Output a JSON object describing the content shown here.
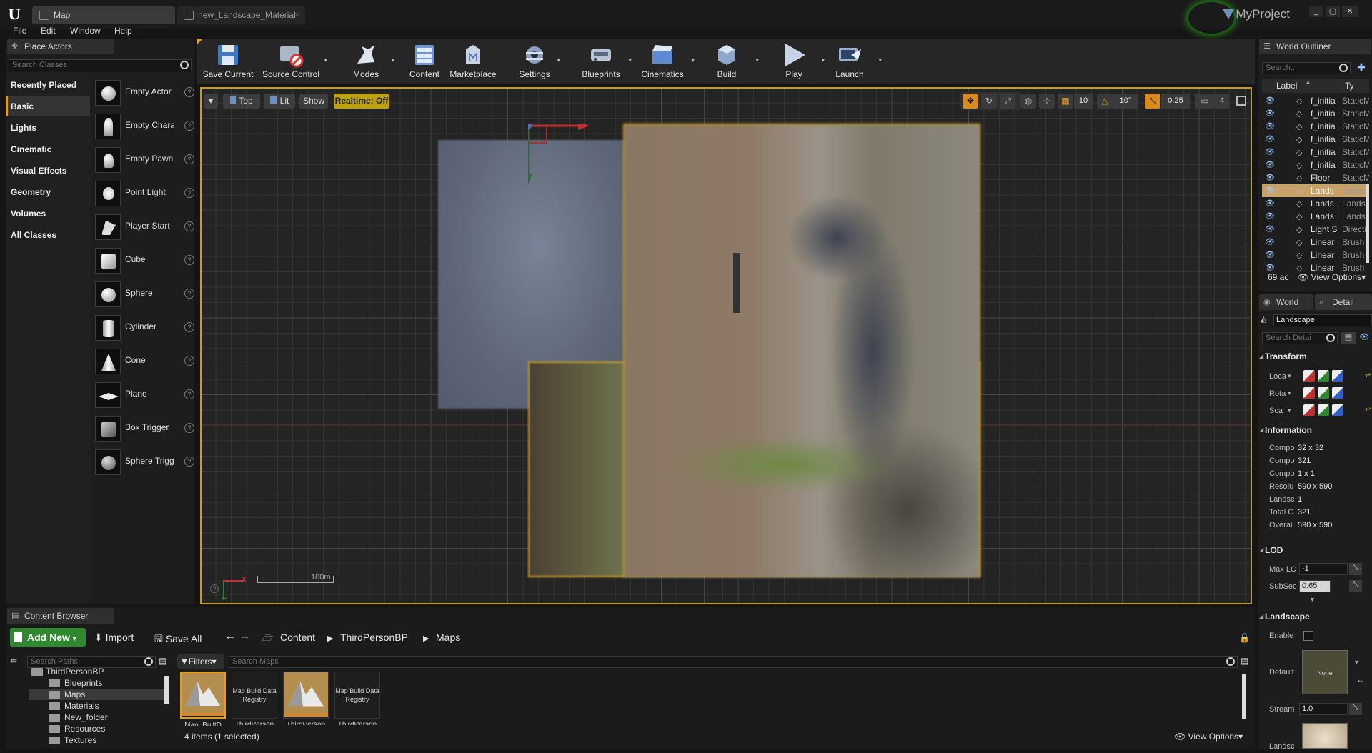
{
  "window": {
    "logo": "U",
    "project_name": "MyProject",
    "tabs": [
      {
        "label": "Map",
        "close": "×"
      },
      {
        "label": "new_Landscape_Material",
        "close": "×"
      }
    ],
    "controls": [
      "_",
      "▢",
      "✕"
    ]
  },
  "menu": [
    "File",
    "Edit",
    "Window",
    "Help"
  ],
  "place_actors": {
    "tab": "Place Actors",
    "search_placeholder": "Search Classes",
    "categories": [
      "Recently Placed",
      "Basic",
      "Lights",
      "Cinematic",
      "Visual Effects",
      "Geometry",
      "Volumes",
      "All Classes"
    ],
    "selected_category": "Basic",
    "items": [
      "Empty Actor",
      "Empty Character",
      "Empty Pawn",
      "Point Light",
      "Player Start",
      "Cube",
      "Sphere",
      "Cylinder",
      "Cone",
      "Plane",
      "Box Trigger",
      "Sphere Trigger"
    ],
    "help_glyph": "?"
  },
  "toolbar": {
    "buttons": [
      "Save Current",
      "Source Control",
      "Modes",
      "Content",
      "Marketplace",
      "Settings",
      "Blueprints",
      "Cinematics",
      "Build",
      "Play",
      "Launch"
    ],
    "dropdown_glyph": "▾"
  },
  "viewport": {
    "menu_glyph": "▾",
    "view": "Top",
    "lighting": "Lit",
    "show": "Show",
    "realtime": "Realtime: Off",
    "grid_snap": "10",
    "rotation_snap": "10°",
    "scale_snap": "0.25",
    "camera_speed": "4",
    "scale_label": "100m",
    "axis_x": "X",
    "axis_y": "Y"
  },
  "world_outliner": {
    "tab": "World Outliner",
    "search_placeholder": "Search...",
    "col_label": "Label",
    "col_type": "Ty",
    "rows": [
      {
        "label": "f_initia",
        "type": "StaticM",
        "selected": false
      },
      {
        "label": "f_initia",
        "type": "StaticM",
        "selected": false
      },
      {
        "label": "f_initia",
        "type": "StaticM",
        "selected": false
      },
      {
        "label": "f_initia",
        "type": "StaticM",
        "selected": false
      },
      {
        "label": "f_initia",
        "type": "StaticM",
        "selected": false
      },
      {
        "label": "f_initia",
        "type": "StaticM",
        "selected": false
      },
      {
        "label": "Floor",
        "type": "StaticM",
        "selected": false
      },
      {
        "label": "Lands",
        "type": "Landsc",
        "selected": true
      },
      {
        "label": "Lands",
        "type": "Landsc",
        "selected": false
      },
      {
        "label": "Lands",
        "type": "Landsc",
        "selected": false
      },
      {
        "label": "Light S",
        "type": "Directi",
        "selected": false
      },
      {
        "label": "Linear",
        "type": "Brush",
        "selected": false
      },
      {
        "label": "Linear",
        "type": "Brush",
        "selected": false
      },
      {
        "label": "Linear",
        "type": "Brush",
        "selected": false
      }
    ],
    "count": "69 ac",
    "view_options": "View Options"
  },
  "details": {
    "tab_world": "World",
    "tab_details": "Detail",
    "object_name": "Landscape",
    "search_placeholder": "Search Detai",
    "transform_title": "Transform",
    "transform_rows": [
      "Loca",
      "Rota",
      "Sca"
    ],
    "information_title": "Information",
    "info_rows": [
      {
        "label": "Compo",
        "value": "32 x 32"
      },
      {
        "label": "Compo",
        "value": "321"
      },
      {
        "label": "Compo",
        "value": "1 x 1"
      },
      {
        "label": "Resolu",
        "value": "590 x 590"
      },
      {
        "label": "Landsc",
        "value": "1"
      },
      {
        "label": "Total C",
        "value": "321"
      },
      {
        "label": "Overal",
        "value": "590 x 590"
      }
    ],
    "lod_title": "LOD",
    "lod_rows": [
      {
        "label": "Max LC",
        "value": "-1"
      },
      {
        "label": "SubSec",
        "value": "0.65"
      }
    ],
    "landscape_title": "Landscape",
    "enable_label": "Enable",
    "default_label": "Default",
    "default_value": "None",
    "stream_label": "Stream",
    "stream_value": "1.0",
    "landsc_label": "Landsc"
  },
  "content_browser": {
    "tab": "Content Browser",
    "add_new": "Add New",
    "import": "Import",
    "save_all": "Save All",
    "path": [
      "Content",
      "ThirdPersonBP",
      "Maps"
    ],
    "path_search_placeholder": "Search Paths",
    "filters": "Filters",
    "asset_search_placeholder": "Search Maps",
    "folders": [
      "ThirdPersonBP",
      "Blueprints",
      "Maps",
      "Materials",
      "New_folder",
      "Resources",
      "Textures"
    ],
    "selected_folder": "Maps",
    "assets": [
      {
        "kind": "map",
        "caption": "Map_BuiltD"
      },
      {
        "kind": "registry",
        "label": "Map Build Data Registry",
        "caption": "ThirdPerson"
      },
      {
        "kind": "map",
        "caption": "ThirdPerson"
      },
      {
        "kind": "registry",
        "label": "Map Build Data Registry",
        "caption": "ThirdPerson"
      }
    ],
    "status": "4 items (1 selected)",
    "view_options": "View Options"
  },
  "colors": {
    "accent": "#e39e20",
    "selection": "#c8a06a",
    "add_new": "#2f8a2f",
    "realtime": "#bba210",
    "landscape_border": "#c39a2b"
  }
}
